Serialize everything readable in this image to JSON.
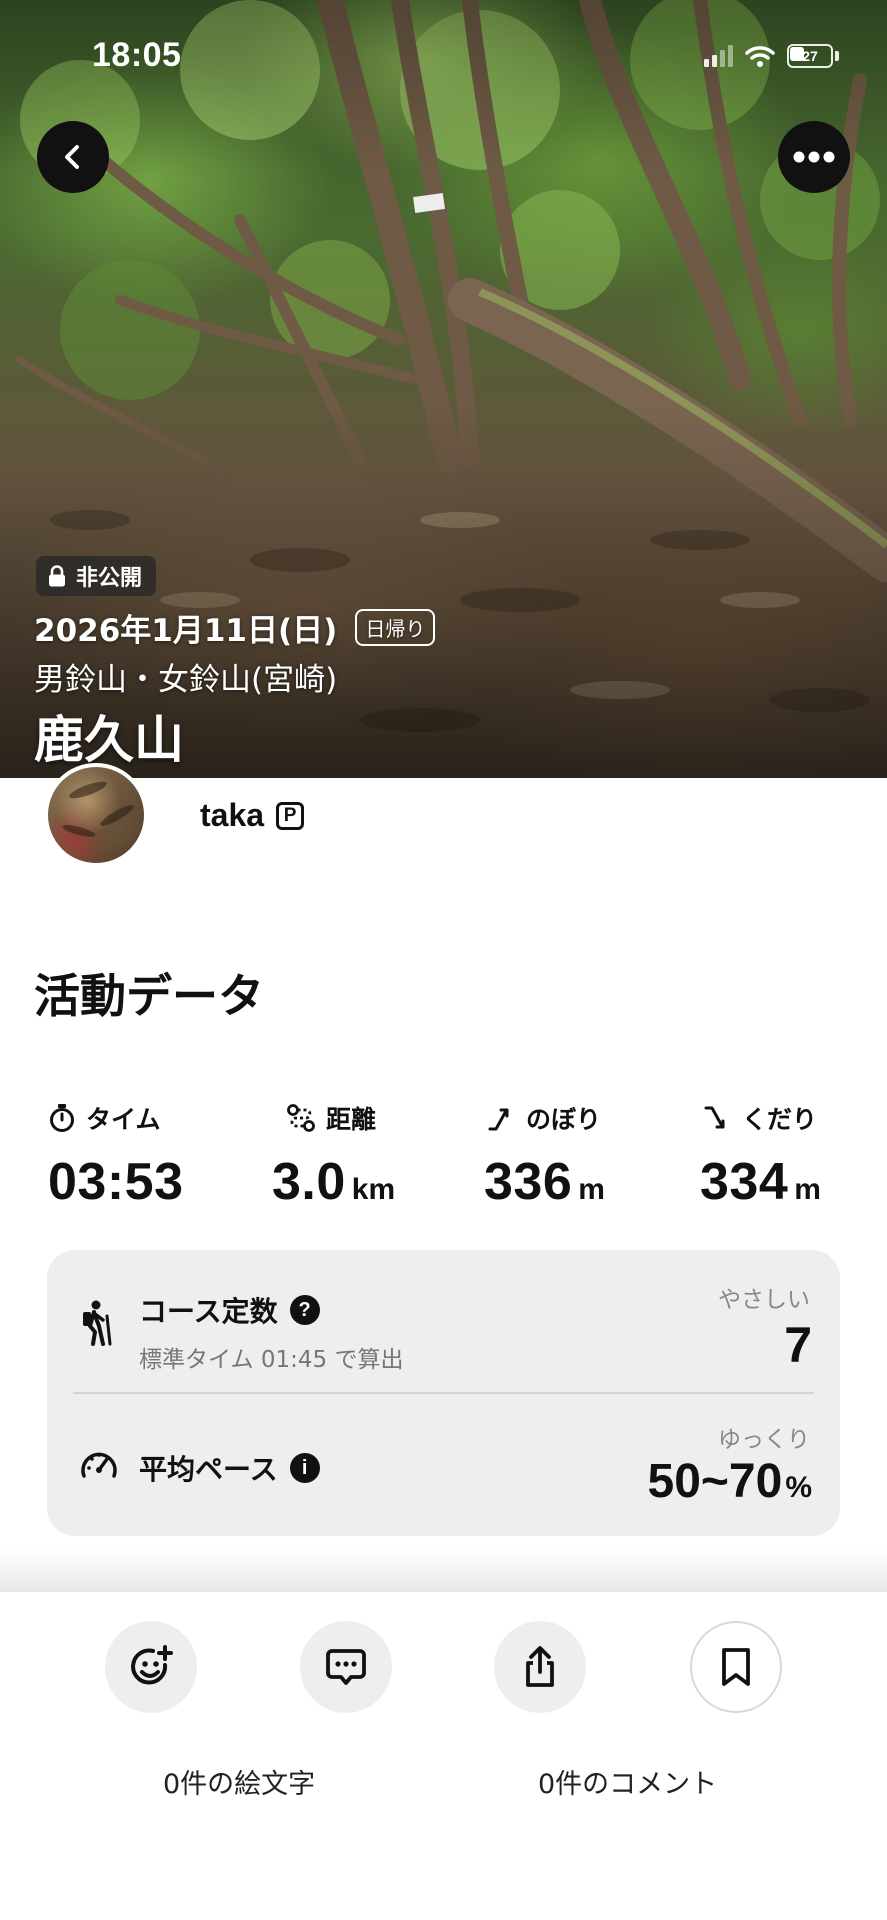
{
  "status_bar": {
    "time": "18:05",
    "battery": "27"
  },
  "hero": {
    "visibility_label": "非公開",
    "date": "2026年1月11日(日)",
    "trip_type": "日帰り",
    "area": "男鈴山・女鈴山(宮崎)",
    "title": "鹿久山"
  },
  "user": {
    "name": "taka",
    "badge": "P"
  },
  "activity": {
    "section_title": "活動データ",
    "stats": [
      {
        "label": "タイム",
        "icon": "stopwatch-icon",
        "value": "03:53",
        "unit": ""
      },
      {
        "label": "距離",
        "icon": "route-icon",
        "value": "3.0",
        "unit": "km"
      },
      {
        "label": "のぼり",
        "icon": "ascent-icon",
        "value": "336",
        "unit": "m"
      },
      {
        "label": "くだり",
        "icon": "descent-icon",
        "value": "334",
        "unit": "m"
      }
    ]
  },
  "course": {
    "title": "コース定数",
    "help": "?",
    "subtitle": "標準タイム 01:45 で算出",
    "level_label": "やさしい",
    "value": "7"
  },
  "pace": {
    "title": "平均ペース",
    "info": "i",
    "level_label": "ゆっくり",
    "value": "50~70",
    "unit": "%"
  },
  "bottom": {
    "emoji_count_label": "0件の絵文字",
    "comment_count_label": "0件のコメント"
  },
  "colors": {
    "card_bg": "#eeeeee",
    "text": "#111111",
    "muted": "#777777"
  }
}
